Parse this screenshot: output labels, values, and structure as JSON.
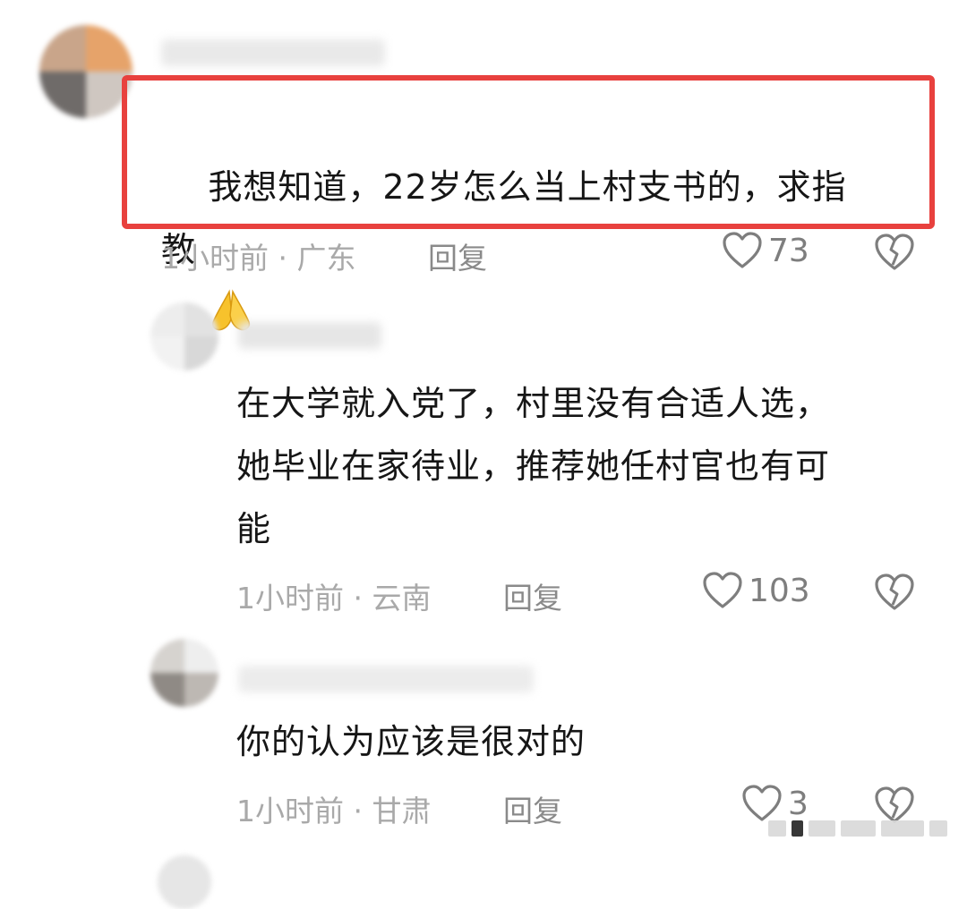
{
  "comments": [
    {
      "text": "我想知道，22岁怎么当上村支书的，求指\n教",
      "time": "1小时前",
      "location": "广东",
      "reply_label": "回复",
      "likes": "73",
      "highlighted": true,
      "has_emoji": true
    },
    {
      "text": "在大学就入党了，村里没有合适人选，\n她毕业在家待业，推荐她任村官也有可\n能",
      "time": "1小时前",
      "location": "云南",
      "reply_label": "回复",
      "likes": "103"
    },
    {
      "text": "你的认为应该是很对的",
      "time": "1小时前",
      "location": "甘肃",
      "reply_label": "回复",
      "likes": "3"
    }
  ],
  "meta_separator": " · ",
  "colors": {
    "highlight": "#e8413e",
    "meta": "#a9a9a9",
    "icon": "#7e7e7e"
  },
  "icons": [
    "heart-outline-icon",
    "broken-heart-icon",
    "folded-hands-emoji"
  ]
}
